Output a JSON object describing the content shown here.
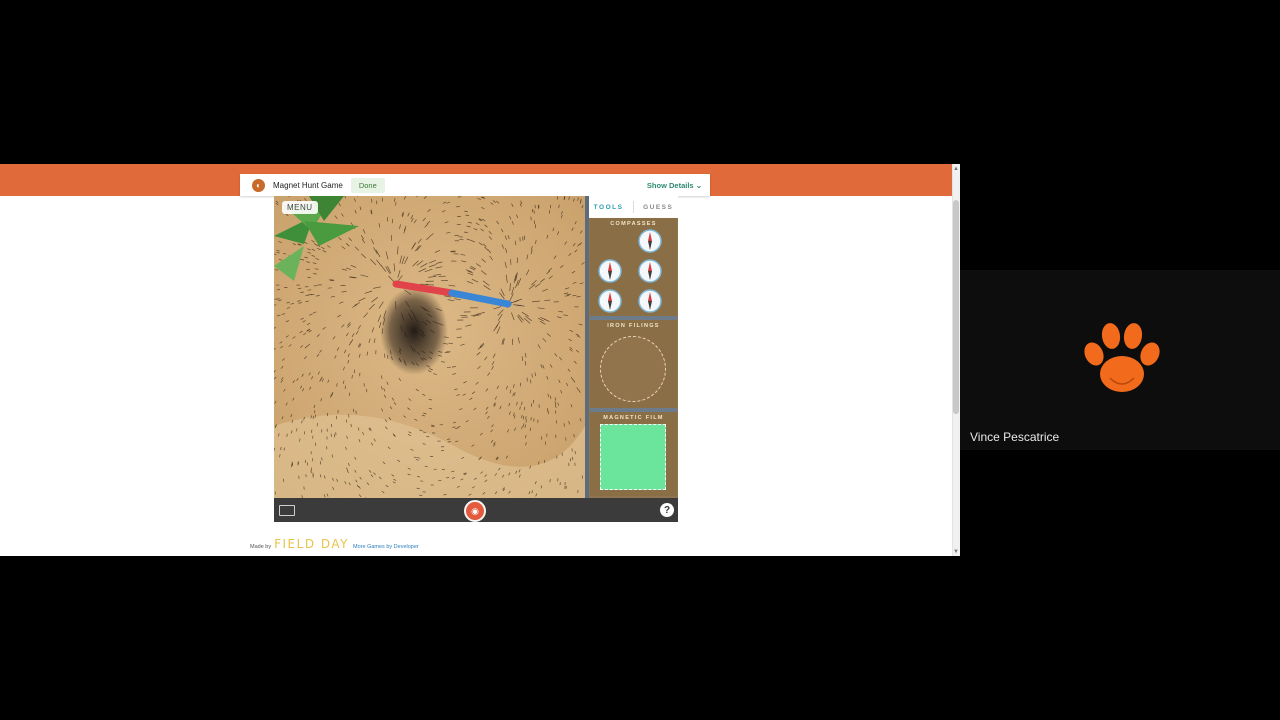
{
  "game": {
    "title": "Magnet Hunt Game",
    "done_label": "Done",
    "show_details_label": "Show Details",
    "menu_label": "MENU",
    "tabs": {
      "tools": "TOOLS",
      "guess": "GUESS"
    },
    "sections": {
      "compasses": "COMPASSES",
      "iron_filings": "IRON FILINGS",
      "magnetic_film": "MAGNETIC FILM"
    },
    "help_label": "?"
  },
  "credits": {
    "made_by": "Made by",
    "brand": "FIELD DAY",
    "more_games": "More Games by Developer"
  },
  "participant": {
    "name": "Vince Pescatrice"
  },
  "colors": {
    "accent_orange": "#e06a3a",
    "magnet_red": "#e0444a",
    "magnet_blue": "#3a86d6",
    "film_green": "#6be59c",
    "tools_tab": "#2a9fb8"
  }
}
